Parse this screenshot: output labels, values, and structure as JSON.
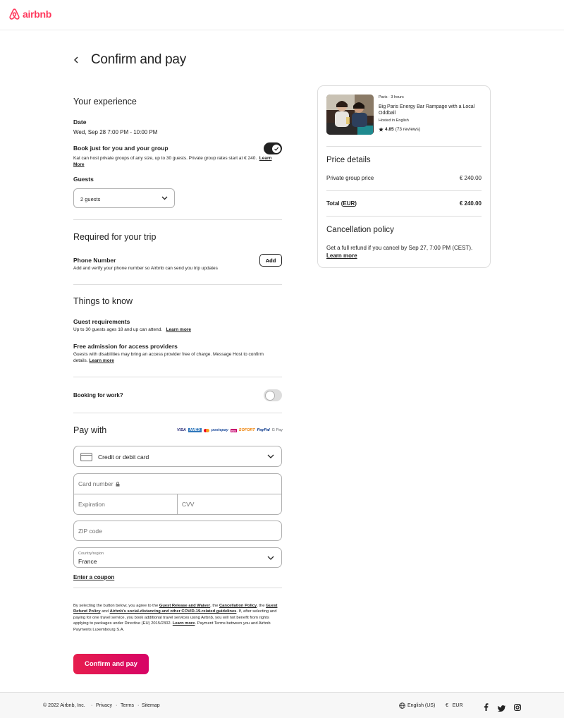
{
  "brand": {
    "name": "airbnb",
    "color": "#ff385c"
  },
  "page": {
    "title": "Confirm and pay"
  },
  "experience": {
    "heading": "Your experience",
    "date_label": "Date",
    "date_value": "Wed, Sep 28 7:00 PM - 10:00 PM",
    "group_label": "Book just for you and your group",
    "group_desc": "Kat can host private groups of any size, up to 30 guests. Private group rates start at € 240.",
    "group_link": "Learn More",
    "guests_label": "Guests",
    "guests_value": "2 guests"
  },
  "required": {
    "heading": "Required for your trip",
    "phone_label": "Phone Number",
    "phone_desc": "Add and verify your phone number so Airbnb can send you trip updates",
    "add_button": "Add"
  },
  "things": {
    "heading": "Things to know",
    "req_label": "Guest requirements",
    "req_desc": "Up to 30 guests ages 18 and up can attend.",
    "req_link": "Learn more",
    "access_label": "Free admission for access providers",
    "access_desc": "Guests with disabilities may bring an access provider free of charge. Message Host to confirm details.",
    "access_link": "Learn more"
  },
  "work": {
    "label": "Booking for work?"
  },
  "pay": {
    "heading": "Pay with",
    "logos": [
      "VISA",
      "AMEX",
      "mastercard",
      "postepay",
      "eps",
      "SOFORT",
      "PayPal",
      "G Pay"
    ],
    "method": "Credit or debit card",
    "card_number_placeholder": "Card number",
    "expiration_placeholder": "Expiration",
    "cvv_placeholder": "CVV",
    "zip_placeholder": "ZIP code",
    "country_label": "Country/region",
    "country_value": "France",
    "coupon_link": "Enter a coupon"
  },
  "legal": {
    "t1": "By selecting the button below, you agree to the ",
    "l1": "Guest Release and Waiver",
    "t2": ", the ",
    "l2": "Cancellation Policy",
    "t3": ", the ",
    "l3": "Guest Refund Policy",
    "t4": " and ",
    "l4": "Airbnb's social-distancing and other COVID-19-related guidelines",
    "t5": ". If, after selecting and paying for one travel service, you book additional travel services using Airbnb, you will not benefit from rights applying to packages under Directive (EU) 2015/2302. ",
    "l5": "Learn more",
    "t6": ". Payment Terms between you and Airbnb Payments Luxembourg S.A."
  },
  "cta": {
    "label": "Confirm and pay"
  },
  "listing": {
    "meta": "Paris · 3 hours",
    "title": "Big Paris Energy Bar Rampage with a Local Oddball",
    "hosted": "Hosted in English",
    "rating": "4.85",
    "reviews": "(73 reviews)"
  },
  "price": {
    "heading": "Price details",
    "line_label": "Private group price",
    "line_value": "€ 240.00",
    "total_label": "Total",
    "total_currency": "EUR",
    "total_value": "€ 240.00"
  },
  "cancellation": {
    "heading": "Cancellation policy",
    "text": "Get a full refund if you cancel by Sep 27, 7:00 PM (CEST).",
    "link": "Learn more"
  },
  "footer": {
    "copyright": "© 2022 Airbnb, Inc.",
    "privacy": "Privacy",
    "terms": "Terms",
    "sitemap": "Sitemap",
    "language": "English (US)",
    "currency_symbol": "€",
    "currency": "EUR"
  }
}
